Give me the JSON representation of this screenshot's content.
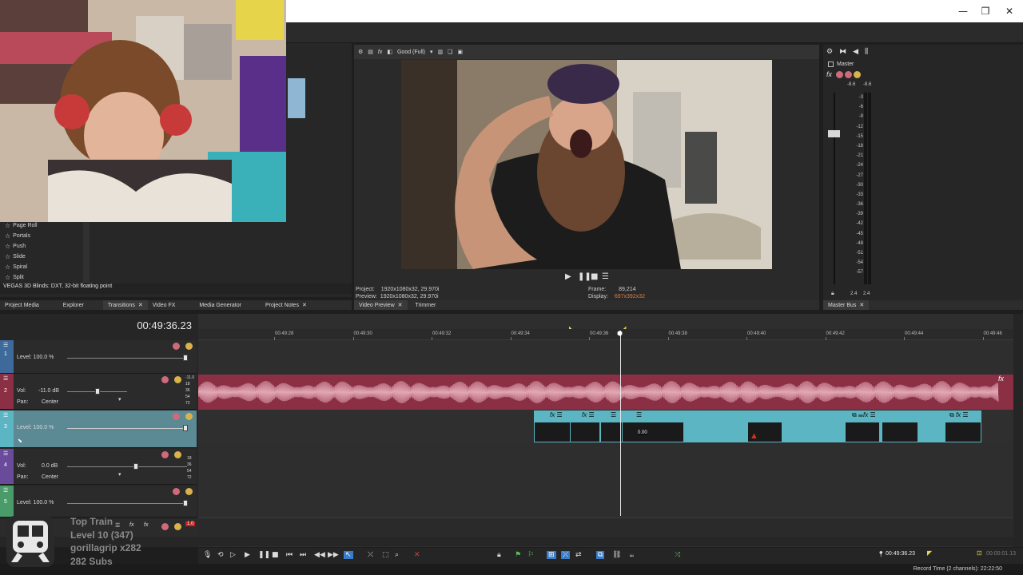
{
  "window": {
    "minimize_glyph": "—",
    "maximize_glyph": "❐",
    "close_glyph": "✕"
  },
  "left_panel": {
    "transitions": [
      "Page Roll",
      "Portals",
      "Push",
      "Slide",
      "Spiral",
      "Split"
    ],
    "status_text": "VEGAS 3D Blinds: DXT, 32-bit floating point",
    "tabs": [
      {
        "label": "Project Media"
      },
      {
        "label": "Explorer"
      },
      {
        "label": "Transitions"
      },
      {
        "label": "Video FX"
      },
      {
        "label": "Media Generator"
      },
      {
        "label": "Project Notes"
      }
    ]
  },
  "preview": {
    "quality": "Good (Full)",
    "project_label": "Project:",
    "project_value": "1920x1080x32, 29.970i",
    "preview_label": "Preview:",
    "preview_value": "1920x1080x32, 29.970i",
    "frame_label": "Frame:",
    "frame_value": "89,214",
    "display_label": "Display:",
    "display_value": "697x392x32",
    "tabs": [
      {
        "label": "Video Preview"
      },
      {
        "label": "Trimmer"
      }
    ]
  },
  "master": {
    "title": "Master",
    "peak_left": "-8.6",
    "peak_right": "-8.6",
    "scale": [
      "3",
      "6",
      "9",
      "12",
      "15",
      "18",
      "21",
      "24",
      "27",
      "30",
      "33",
      "36",
      "39",
      "42",
      "45",
      "48",
      "51",
      "54",
      "57"
    ],
    "bottom_left": "2.4",
    "bottom_right": "2.4",
    "tab": "Master Bus"
  },
  "timeline": {
    "timecode": "00:49:36.23",
    "ruler": [
      "00:49:28",
      "00:49:30",
      "00:49:32",
      "00:49:34",
      "00:49:36",
      "00:49:38",
      "00:49:40",
      "00:49:42",
      "00:49:44",
      "00:49:46"
    ],
    "tracks": [
      {
        "num": "1",
        "kind": "video",
        "level": "Level: 100.0 %",
        "color": "#3d6a9b"
      },
      {
        "num": "2",
        "kind": "audio",
        "vol_label": "Vol:",
        "vol_value": "-11.0 dB",
        "pan_label": "Pan:",
        "pan_value": "Center",
        "color": "#8b2f45",
        "meter": [
          "-11.0",
          "18",
          "36",
          "54",
          "72"
        ]
      },
      {
        "num": "3",
        "kind": "video",
        "level": "Level: 100.0 %",
        "color": "#5bb5c2"
      },
      {
        "num": "4",
        "kind": "audio",
        "vol_label": "Vol:",
        "vol_value": "0.0 dB",
        "pan_label": "Pan:",
        "pan_value": "Center",
        "color": "#6a4a9b",
        "meter": [
          "18",
          "36",
          "54",
          "72"
        ]
      },
      {
        "num": "5",
        "kind": "video",
        "level": "Level: 100.0 %",
        "color": "#4a9b6a"
      }
    ],
    "master_row_value": "1.0",
    "clip_time": "0.00",
    "cursor_time": "00:49:36.23",
    "record_time": "Record Time (2 channels): 22:22:50",
    "end_time": "00:00:01.13"
  },
  "overlay": {
    "line1": "Top Train",
    "line2": "Level 10 (347)",
    "line3": "gorillagrip x282",
    "line4": "282 Subs"
  },
  "colors": {
    "audio_clip": "#8b2f45",
    "video_clip": "#5bb5c2",
    "accent_orange": "#e07b3a"
  }
}
